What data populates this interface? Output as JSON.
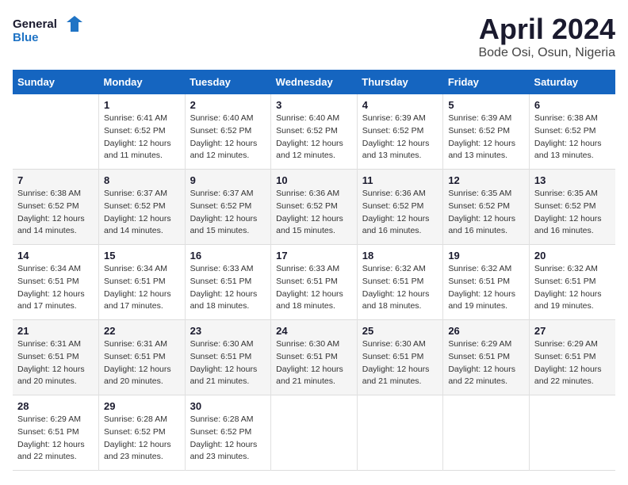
{
  "logo": {
    "line1": "General",
    "line2": "Blue"
  },
  "title": "April 2024",
  "subtitle": "Bode Osi, Osun, Nigeria",
  "headers": [
    "Sunday",
    "Monday",
    "Tuesday",
    "Wednesday",
    "Thursday",
    "Friday",
    "Saturday"
  ],
  "weeks": [
    [
      {
        "day": "",
        "sunrise": "",
        "sunset": "",
        "daylight": ""
      },
      {
        "day": "1",
        "sunrise": "Sunrise: 6:41 AM",
        "sunset": "Sunset: 6:52 PM",
        "daylight": "Daylight: 12 hours and 11 minutes."
      },
      {
        "day": "2",
        "sunrise": "Sunrise: 6:40 AM",
        "sunset": "Sunset: 6:52 PM",
        "daylight": "Daylight: 12 hours and 12 minutes."
      },
      {
        "day": "3",
        "sunrise": "Sunrise: 6:40 AM",
        "sunset": "Sunset: 6:52 PM",
        "daylight": "Daylight: 12 hours and 12 minutes."
      },
      {
        "day": "4",
        "sunrise": "Sunrise: 6:39 AM",
        "sunset": "Sunset: 6:52 PM",
        "daylight": "Daylight: 12 hours and 13 minutes."
      },
      {
        "day": "5",
        "sunrise": "Sunrise: 6:39 AM",
        "sunset": "Sunset: 6:52 PM",
        "daylight": "Daylight: 12 hours and 13 minutes."
      },
      {
        "day": "6",
        "sunrise": "Sunrise: 6:38 AM",
        "sunset": "Sunset: 6:52 PM",
        "daylight": "Daylight: 12 hours and 13 minutes."
      }
    ],
    [
      {
        "day": "7",
        "sunrise": "Sunrise: 6:38 AM",
        "sunset": "Sunset: 6:52 PM",
        "daylight": "Daylight: 12 hours and 14 minutes."
      },
      {
        "day": "8",
        "sunrise": "Sunrise: 6:37 AM",
        "sunset": "Sunset: 6:52 PM",
        "daylight": "Daylight: 12 hours and 14 minutes."
      },
      {
        "day": "9",
        "sunrise": "Sunrise: 6:37 AM",
        "sunset": "Sunset: 6:52 PM",
        "daylight": "Daylight: 12 hours and 15 minutes."
      },
      {
        "day": "10",
        "sunrise": "Sunrise: 6:36 AM",
        "sunset": "Sunset: 6:52 PM",
        "daylight": "Daylight: 12 hours and 15 minutes."
      },
      {
        "day": "11",
        "sunrise": "Sunrise: 6:36 AM",
        "sunset": "Sunset: 6:52 PM",
        "daylight": "Daylight: 12 hours and 16 minutes."
      },
      {
        "day": "12",
        "sunrise": "Sunrise: 6:35 AM",
        "sunset": "Sunset: 6:52 PM",
        "daylight": "Daylight: 12 hours and 16 minutes."
      },
      {
        "day": "13",
        "sunrise": "Sunrise: 6:35 AM",
        "sunset": "Sunset: 6:52 PM",
        "daylight": "Daylight: 12 hours and 16 minutes."
      }
    ],
    [
      {
        "day": "14",
        "sunrise": "Sunrise: 6:34 AM",
        "sunset": "Sunset: 6:51 PM",
        "daylight": "Daylight: 12 hours and 17 minutes."
      },
      {
        "day": "15",
        "sunrise": "Sunrise: 6:34 AM",
        "sunset": "Sunset: 6:51 PM",
        "daylight": "Daylight: 12 hours and 17 minutes."
      },
      {
        "day": "16",
        "sunrise": "Sunrise: 6:33 AM",
        "sunset": "Sunset: 6:51 PM",
        "daylight": "Daylight: 12 hours and 18 minutes."
      },
      {
        "day": "17",
        "sunrise": "Sunrise: 6:33 AM",
        "sunset": "Sunset: 6:51 PM",
        "daylight": "Daylight: 12 hours and 18 minutes."
      },
      {
        "day": "18",
        "sunrise": "Sunrise: 6:32 AM",
        "sunset": "Sunset: 6:51 PM",
        "daylight": "Daylight: 12 hours and 18 minutes."
      },
      {
        "day": "19",
        "sunrise": "Sunrise: 6:32 AM",
        "sunset": "Sunset: 6:51 PM",
        "daylight": "Daylight: 12 hours and 19 minutes."
      },
      {
        "day": "20",
        "sunrise": "Sunrise: 6:32 AM",
        "sunset": "Sunset: 6:51 PM",
        "daylight": "Daylight: 12 hours and 19 minutes."
      }
    ],
    [
      {
        "day": "21",
        "sunrise": "Sunrise: 6:31 AM",
        "sunset": "Sunset: 6:51 PM",
        "daylight": "Daylight: 12 hours and 20 minutes."
      },
      {
        "day": "22",
        "sunrise": "Sunrise: 6:31 AM",
        "sunset": "Sunset: 6:51 PM",
        "daylight": "Daylight: 12 hours and 20 minutes."
      },
      {
        "day": "23",
        "sunrise": "Sunrise: 6:30 AM",
        "sunset": "Sunset: 6:51 PM",
        "daylight": "Daylight: 12 hours and 21 minutes."
      },
      {
        "day": "24",
        "sunrise": "Sunrise: 6:30 AM",
        "sunset": "Sunset: 6:51 PM",
        "daylight": "Daylight: 12 hours and 21 minutes."
      },
      {
        "day": "25",
        "sunrise": "Sunrise: 6:30 AM",
        "sunset": "Sunset: 6:51 PM",
        "daylight": "Daylight: 12 hours and 21 minutes."
      },
      {
        "day": "26",
        "sunrise": "Sunrise: 6:29 AM",
        "sunset": "Sunset: 6:51 PM",
        "daylight": "Daylight: 12 hours and 22 minutes."
      },
      {
        "day": "27",
        "sunrise": "Sunrise: 6:29 AM",
        "sunset": "Sunset: 6:51 PM",
        "daylight": "Daylight: 12 hours and 22 minutes."
      }
    ],
    [
      {
        "day": "28",
        "sunrise": "Sunrise: 6:29 AM",
        "sunset": "Sunset: 6:51 PM",
        "daylight": "Daylight: 12 hours and 22 minutes."
      },
      {
        "day": "29",
        "sunrise": "Sunrise: 6:28 AM",
        "sunset": "Sunset: 6:52 PM",
        "daylight": "Daylight: 12 hours and 23 minutes."
      },
      {
        "day": "30",
        "sunrise": "Sunrise: 6:28 AM",
        "sunset": "Sunset: 6:52 PM",
        "daylight": "Daylight: 12 hours and 23 minutes."
      },
      {
        "day": "",
        "sunrise": "",
        "sunset": "",
        "daylight": ""
      },
      {
        "day": "",
        "sunrise": "",
        "sunset": "",
        "daylight": ""
      },
      {
        "day": "",
        "sunrise": "",
        "sunset": "",
        "daylight": ""
      },
      {
        "day": "",
        "sunrise": "",
        "sunset": "",
        "daylight": ""
      }
    ]
  ]
}
